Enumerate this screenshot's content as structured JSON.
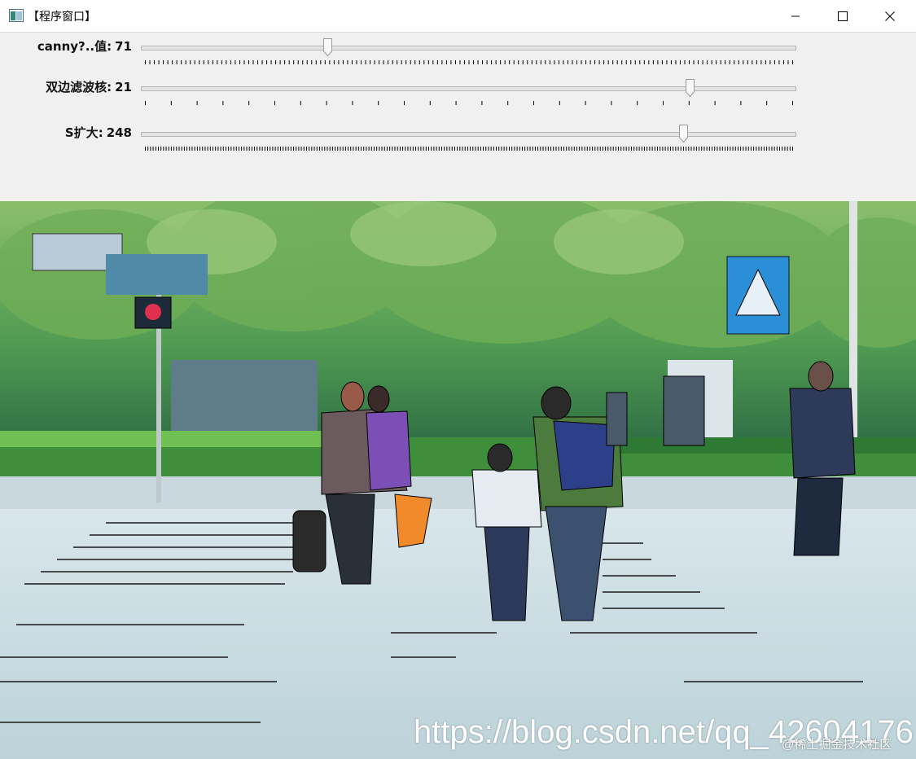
{
  "window": {
    "title": "【程序窗口】",
    "icon": "app-window-icon",
    "buttons": [
      "minimize-icon",
      "maximize-icon",
      "close-icon"
    ]
  },
  "trackbars": [
    {
      "label": "canny?..值",
      "value": "71",
      "fraction": 0.286
    },
    {
      "label": "双边滤波核",
      "value": "21",
      "fraction": 0.84
    },
    {
      "label": "S扩大",
      "value": "248",
      "fraction": 0.83
    }
  ],
  "image": {
    "description_icon": "cartoonized-crosswalk-image",
    "watermark": "https://blog.csdn.net/qq_42604176",
    "watermark_sub": "@稀土掘金技术社区"
  },
  "colors": {
    "titlebar": "#ffffff",
    "panel": "#f0f0f0",
    "track": "#e4e4e4"
  }
}
